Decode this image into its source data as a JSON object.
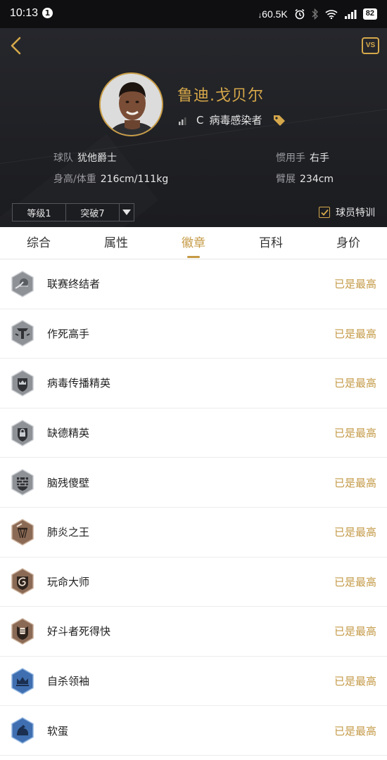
{
  "status_bar": {
    "time": "10:13",
    "notification_count": "1",
    "network_speed": "60.5K",
    "battery": "82"
  },
  "header": {
    "vs_label": "VS",
    "player_name": "鲁迪.戈贝尔",
    "position": "C",
    "archetype": "病毒感染者",
    "team_label": "球队",
    "team_value": "犹他爵士",
    "hand_label": "惯用手",
    "hand_value": "右手",
    "body_label": "身高/体重",
    "body_value": "216cm/111kg",
    "wingspan_label": "臂展",
    "wingspan_value": "234cm",
    "level": "等级1",
    "breakthrough": "突破7",
    "special_label": "球员特训",
    "special_checked": true
  },
  "tabs": [
    {
      "label": "综合",
      "active": false
    },
    {
      "label": "属性",
      "active": false
    },
    {
      "label": "徽章",
      "active": true
    },
    {
      "label": "百科",
      "active": false
    },
    {
      "label": "身价",
      "active": false
    }
  ],
  "badges": [
    {
      "name": "联赛终结者",
      "status": "已是最高",
      "icon": "basketball-dunk-badge-icon",
      "tier": "silver"
    },
    {
      "name": "作死高手",
      "status": "已是最高",
      "icon": "shield-t-badge-icon",
      "tier": "silver"
    },
    {
      "name": "病毒传播精英",
      "status": "已是最高",
      "icon": "shield-crown-badge-icon",
      "tier": "silver"
    },
    {
      "name": "缺德精英",
      "status": "已是最高",
      "icon": "shield-lock-badge-icon",
      "tier": "silver"
    },
    {
      "name": "脑残傻壁",
      "status": "已是最高",
      "icon": "brick-wall-badge-icon",
      "tier": "silver"
    },
    {
      "name": "肺炎之王",
      "status": "已是最高",
      "icon": "hoop-net-badge-icon",
      "tier": "bronze"
    },
    {
      "name": "玩命大师",
      "status": "已是最高",
      "icon": "swirl-badge-icon",
      "tier": "bronze"
    },
    {
      "name": "好斗者死得快",
      "status": "已是最高",
      "icon": "fist-badge-icon",
      "tier": "bronze"
    },
    {
      "name": "自杀领袖",
      "status": "已是最高",
      "icon": "crown-badge-icon",
      "tier": "blue"
    },
    {
      "name": "软蛋",
      "status": "已是最高",
      "icon": "flex-arm-badge-icon",
      "tier": "blue"
    }
  ],
  "colors": {
    "accent_gold": "#c59a45",
    "header_bg": "#232428",
    "silver": "#8e9196",
    "bronze": "#8a6a55",
    "blue": "#3f6fb0"
  }
}
